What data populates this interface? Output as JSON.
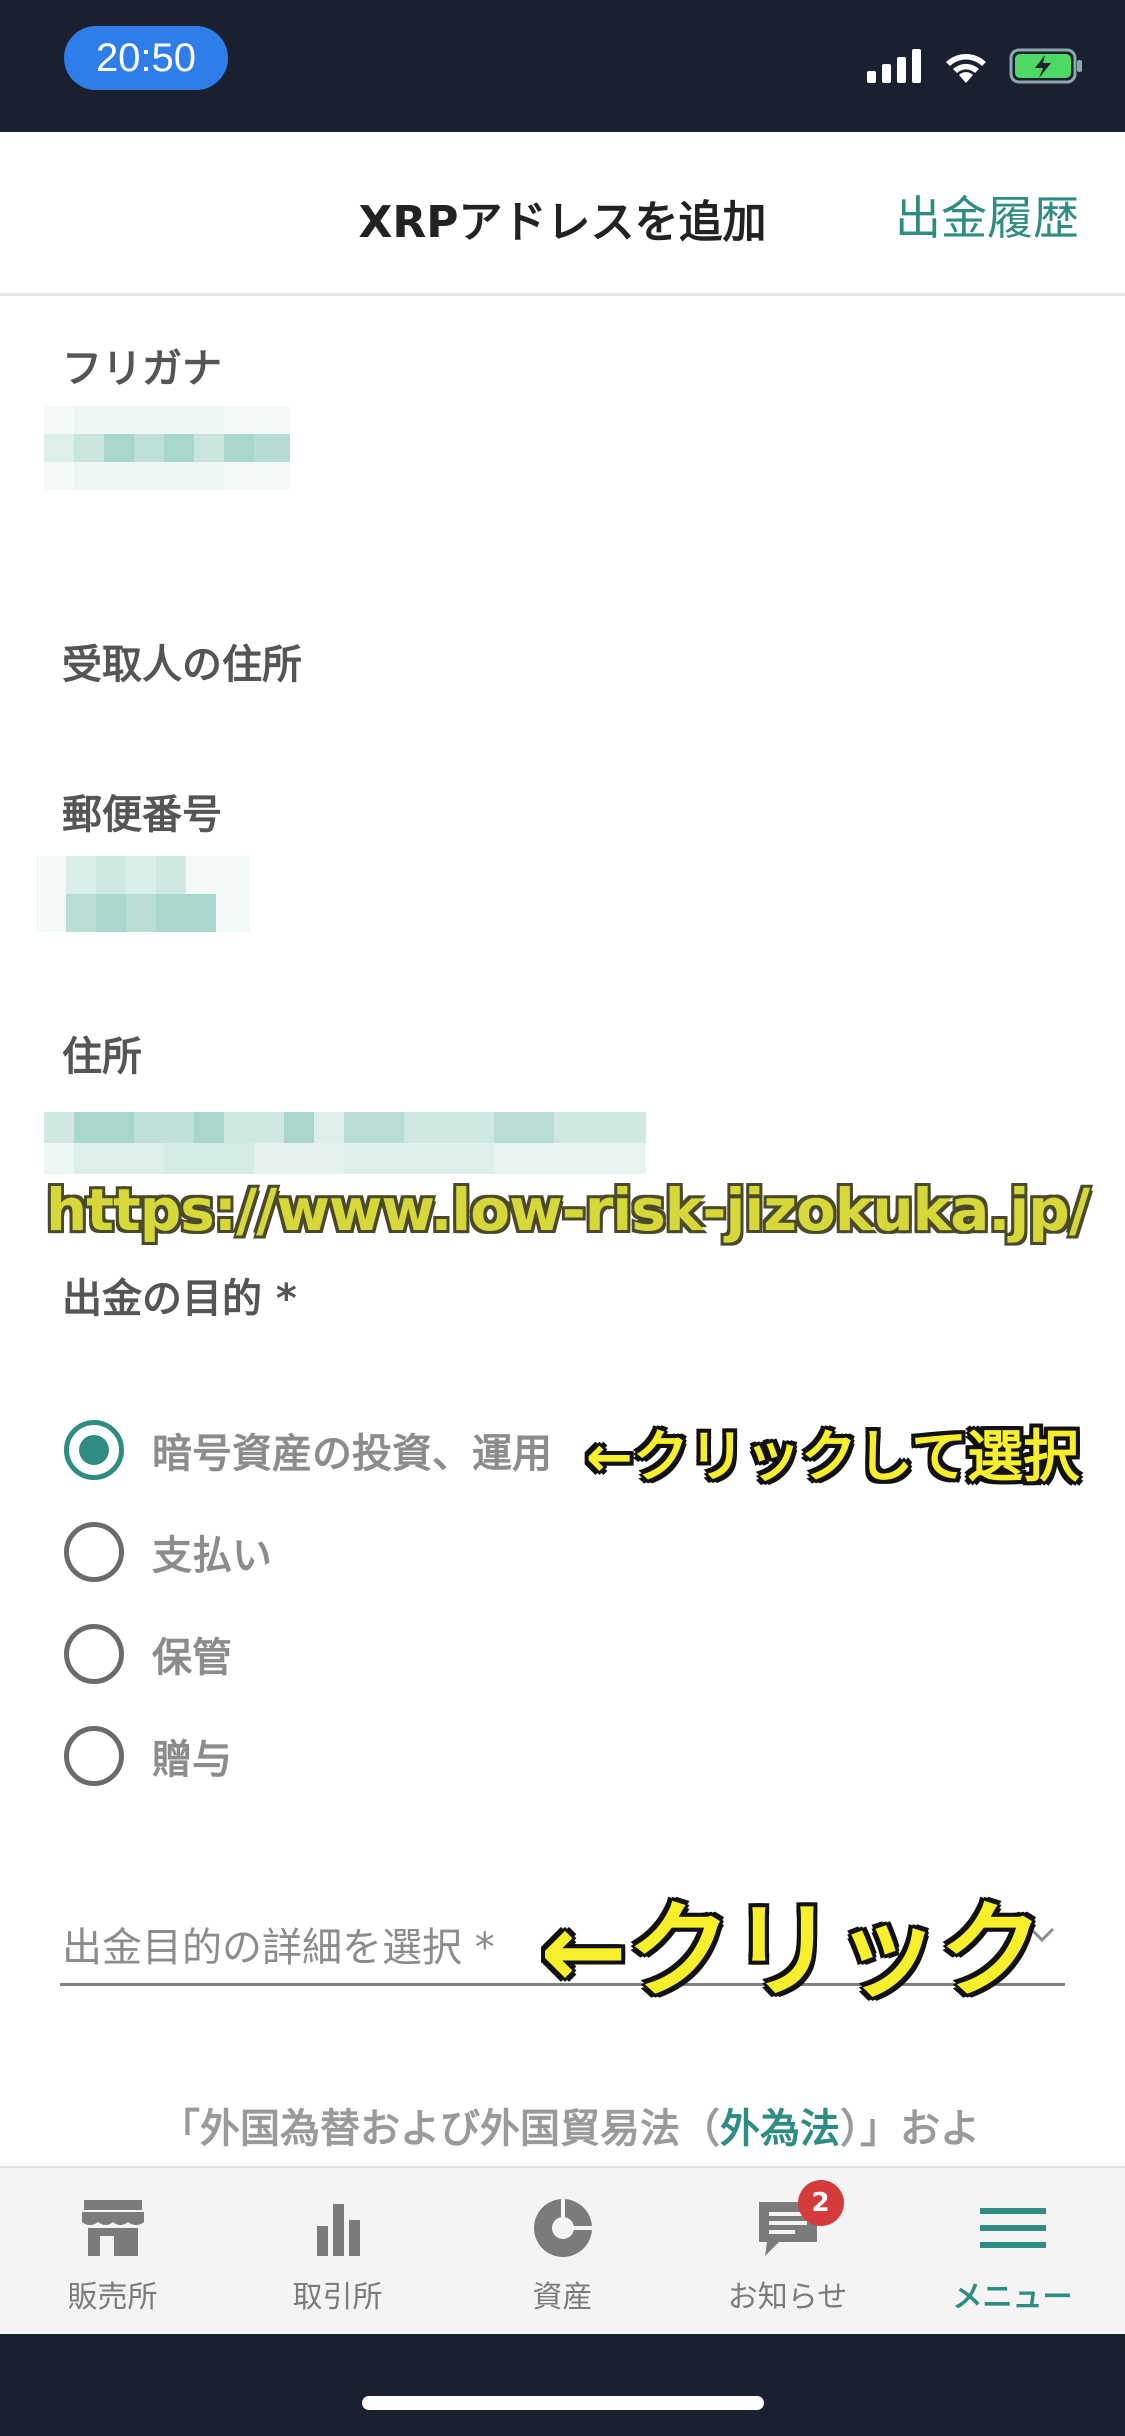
{
  "status_bar": {
    "time": "20:50",
    "battery_color": "#4cd964"
  },
  "header": {
    "title": "XRPアドレスを追加",
    "right_link": "出金履歴"
  },
  "form": {
    "furigana_label": "フリガナ",
    "recipient_address_label": "受取人の住所",
    "postal_code_label": "郵便番号",
    "address_label": "住所",
    "purpose_label": "出金の目的 *",
    "purpose_options": [
      {
        "label": "暗号資産の投資、運用",
        "selected": true
      },
      {
        "label": "支払い",
        "selected": false
      },
      {
        "label": "保管",
        "selected": false
      },
      {
        "label": "贈与",
        "selected": false
      }
    ],
    "detail_select_placeholder": "出金目的の詳細を選択 *"
  },
  "watermark_url": "https://www.low-risk-jizokuka.jp/",
  "annotations": {
    "select_hint": "←クリックして選択",
    "click_hint": "←クリック"
  },
  "notice": {
    "prefix": "「外国為替および外国貿易法（",
    "link": "外為法",
    "suffix": "）」およ"
  },
  "tab_bar": {
    "tabs": [
      {
        "label": "販売所",
        "icon": "store-icon",
        "active": false
      },
      {
        "label": "取引所",
        "icon": "bar-chart-icon",
        "active": false
      },
      {
        "label": "資産",
        "icon": "pie-chart-icon",
        "active": false
      },
      {
        "label": "お知らせ",
        "icon": "message-icon",
        "active": false,
        "badge": "2"
      },
      {
        "label": "メニュー",
        "icon": "menu-icon",
        "active": true
      }
    ]
  },
  "colors": {
    "accent": "#2f8c82",
    "badge": "#d63b3b",
    "annotation": "#f7ef2c"
  }
}
